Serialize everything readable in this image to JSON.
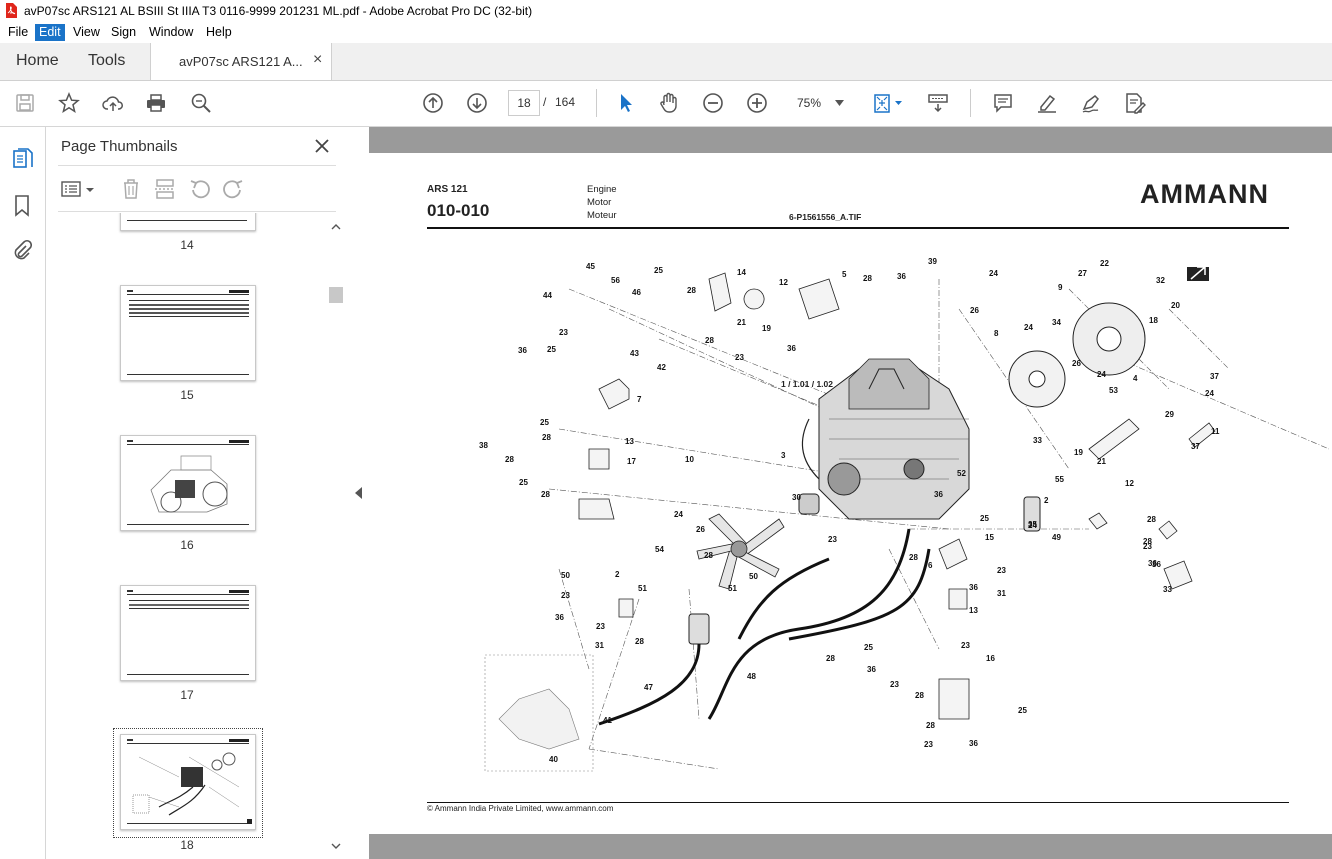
{
  "window": {
    "title": "avP07sc ARS121 AL BSIII St IIIA T3 0116-9999 201231 ML.pdf - Adobe Acrobat Pro DC (32-bit)"
  },
  "menu": [
    "File",
    "Edit",
    "View",
    "Sign",
    "Window",
    "Help"
  ],
  "tabs": {
    "home": "Home",
    "tools": "Tools",
    "doc": "avP07sc ARS121 A...",
    "close": "×"
  },
  "toolbar": {
    "page_current": "18",
    "page_separator": "/",
    "page_total": "164",
    "zoom": "75%"
  },
  "thumbpanel": {
    "title": "Page Thumbnails",
    "pages": [
      "14",
      "15",
      "16",
      "17",
      "18"
    ]
  },
  "document": {
    "model": "ARS 121",
    "code": "010-010",
    "desc": [
      "Engine",
      "Motor",
      "Moteur"
    ],
    "file": "6-P1561556_A.TIF",
    "brand": "AMMANN",
    "assembly_ref": "1 / 1.01 / 1.02",
    "footer": "© Ammann India Private Limited, www.ammann.com",
    "callouts": [
      "45",
      "44",
      "56",
      "46",
      "25",
      "28",
      "14",
      "12",
      "5",
      "28",
      "36",
      "39",
      "24",
      "26",
      "22",
      "27",
      "32",
      "9",
      "20",
      "18",
      "23",
      "25",
      "36",
      "43",
      "42",
      "21",
      "19",
      "28",
      "23",
      "36",
      "34",
      "24",
      "8",
      "7",
      "25",
      "28",
      "13",
      "38",
      "28",
      "17",
      "25",
      "28",
      "26",
      "24",
      "53",
      "4",
      "37",
      "24",
      "29",
      "11",
      "37",
      "10",
      "3",
      "30",
      "19",
      "21",
      "33",
      "55",
      "12",
      "28",
      "23",
      "36",
      "26",
      "24",
      "2",
      "24",
      "35",
      "49",
      "23",
      "25",
      "15",
      "28",
      "36",
      "33",
      "54",
      "28",
      "50",
      "51",
      "50",
      "2",
      "23",
      "51",
      "36",
      "28",
      "23",
      "31",
      "6",
      "23",
      "31",
      "13",
      "25",
      "28",
      "16",
      "36",
      "23",
      "28",
      "36",
      "23",
      "28",
      "25",
      "47",
      "48",
      "41",
      "40",
      "52",
      "36",
      "28",
      "23",
      "36"
    ]
  },
  "colors": {
    "accent": "#1a73c8",
    "doc_bg": "#9a9a9a"
  }
}
